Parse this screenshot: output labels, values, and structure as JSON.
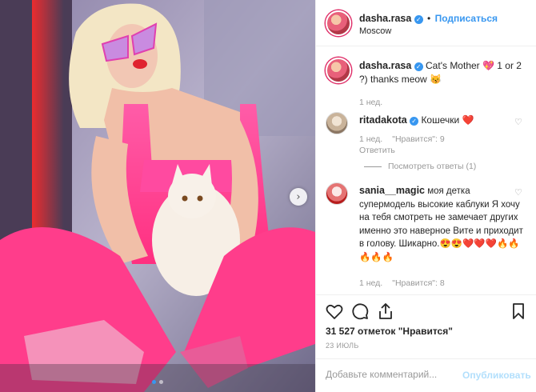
{
  "post": {
    "author": "dasha.rasa",
    "follow_label": "Подписаться",
    "separator": "•",
    "location": "Moscow",
    "verified_mark": "✓"
  },
  "caption": {
    "author": "dasha.rasa",
    "text": "Cat's Mother 💖 1 or 2 ?) thanks meow 😽",
    "time": "1 нед."
  },
  "comments": [
    {
      "author": "ritadakota",
      "text": "Кошечки ❤️",
      "time": "1 нед.",
      "likes": "\"Нравится\": 9",
      "reply": "Ответить",
      "view_replies": "Посмотреть ответы (1)"
    },
    {
      "author": "sania__magic",
      "text": "моя детка супермодель высокие каблуки Я хочу на тебя смотреть не замечает других именно это наверное Вите и приходит в голову. Шикарно.😍😍❤️❤️❤️🔥🔥🔥🔥🔥",
      "time": "1 нед.",
      "likes": "\"Нравится\": 8"
    }
  ],
  "actions": {
    "likes_text": "31 527 отметок \"Нравится\"",
    "date": "23 ИЮЛЬ"
  },
  "add_comment": {
    "placeholder": "Добавьте комментарий...",
    "publish_label": "Опубликовать"
  },
  "carousel": {
    "next_glyph": "›",
    "total": 2,
    "active": 1
  },
  "colors": {
    "accent": "#3897f0",
    "like_red": "#ed4956",
    "muted": "#999999",
    "pink": "#ff3d8b"
  },
  "icons": {
    "heart": "heart-icon",
    "comment": "comment-icon",
    "share": "share-icon",
    "bookmark": "bookmark-icon",
    "verified": "verified-badge-icon",
    "next": "chevron-right-icon"
  }
}
